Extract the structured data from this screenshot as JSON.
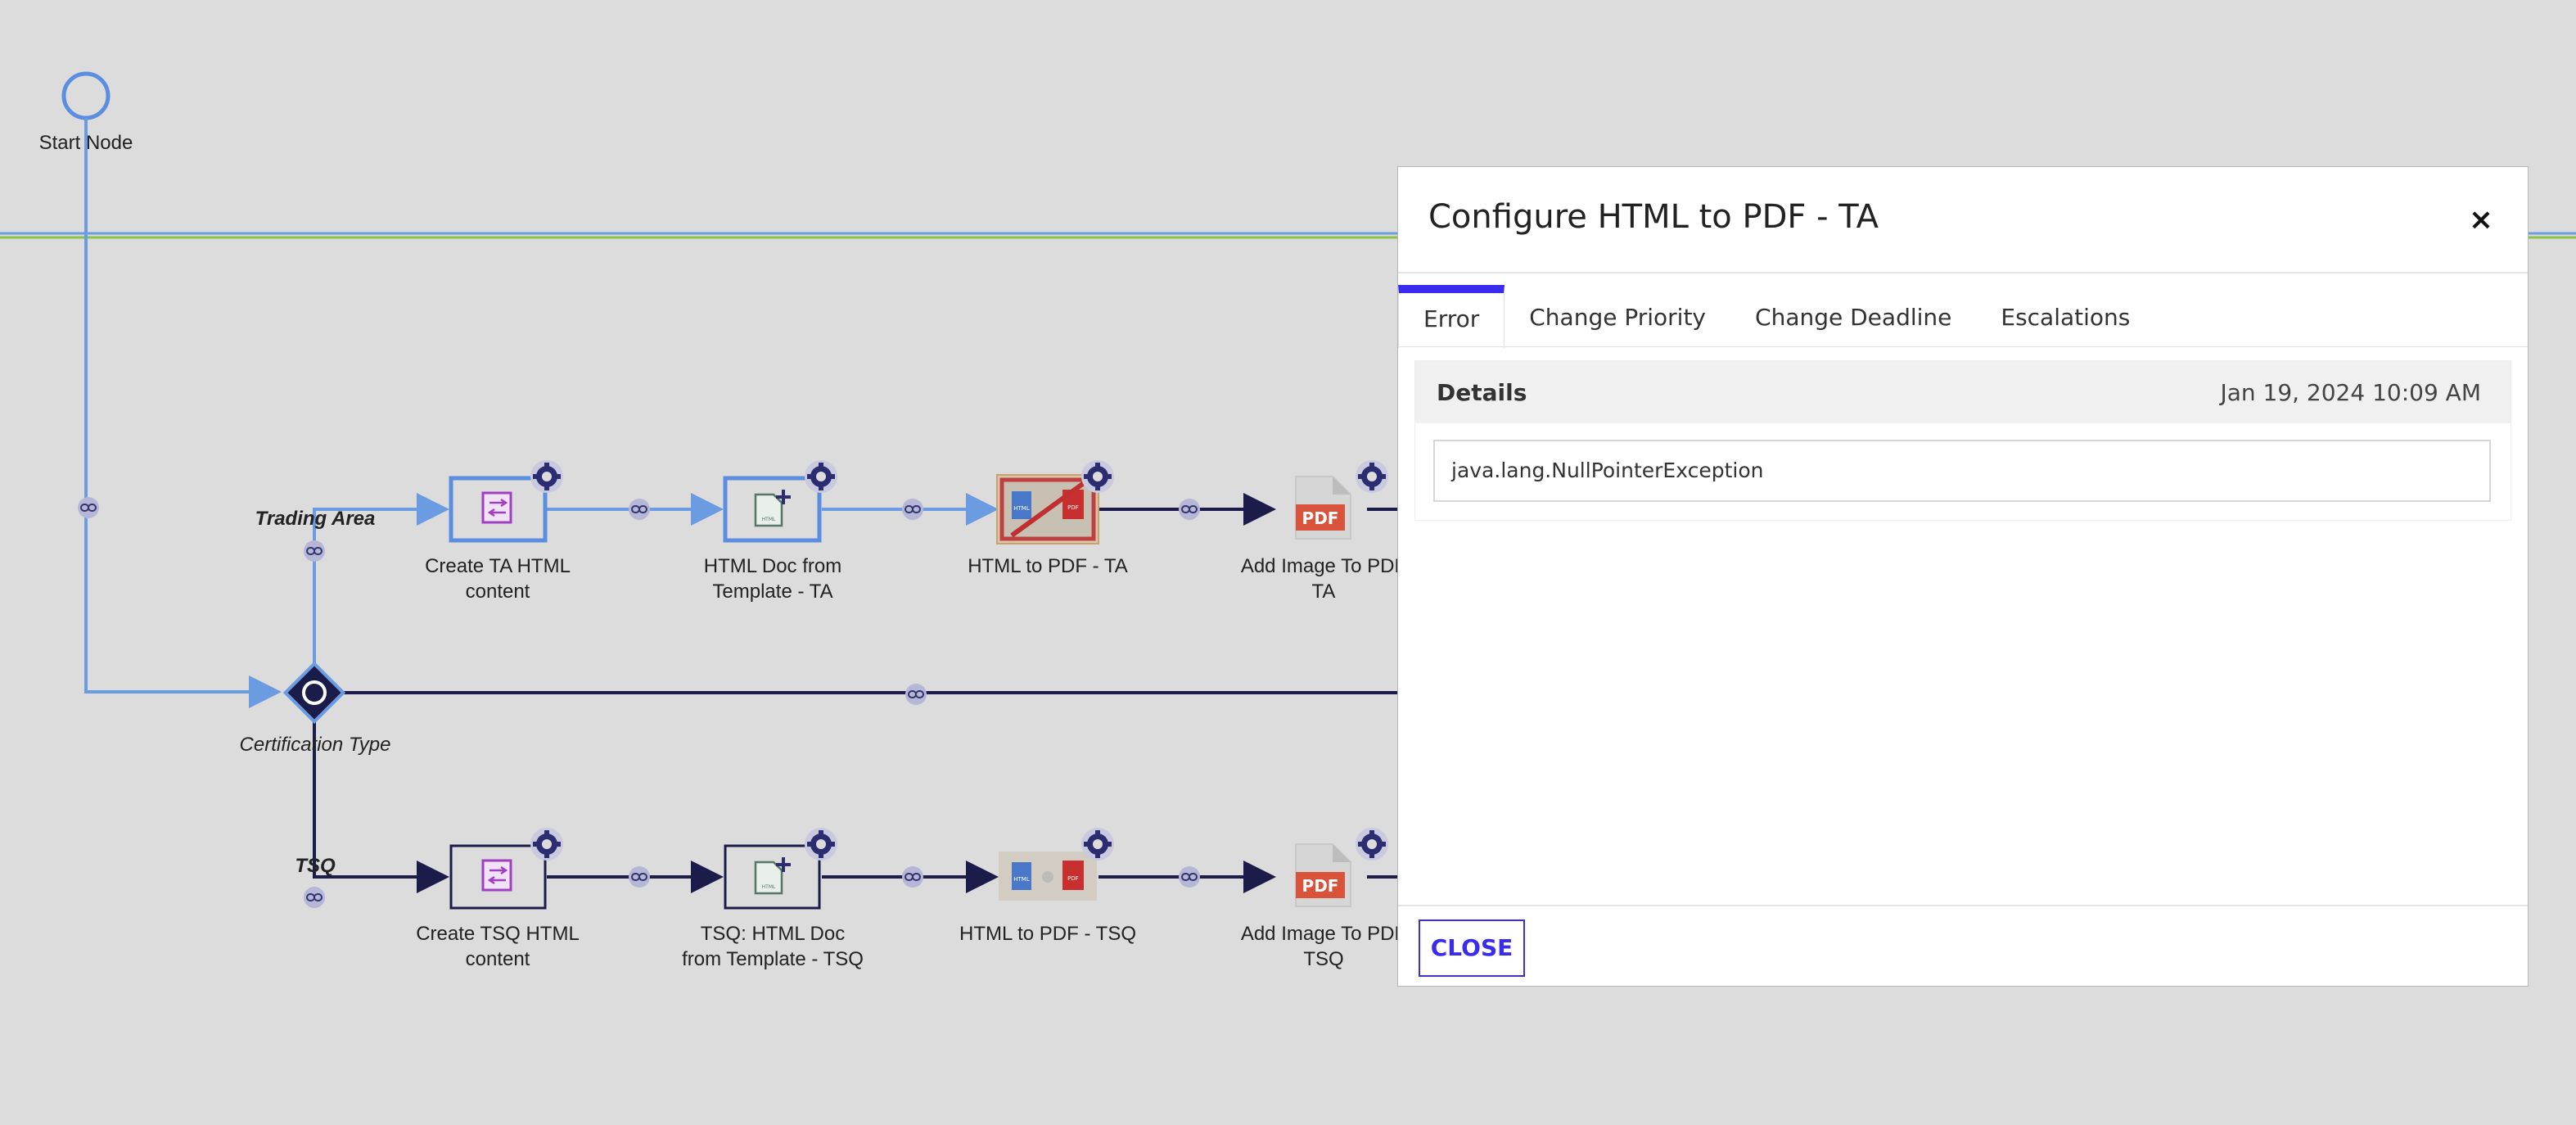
{
  "flow": {
    "start_node": "Start Node",
    "lanes": {
      "trading_area": "Trading Area",
      "tsq": "TSQ"
    },
    "gateway_label": "Certification Type",
    "ta_row": [
      {
        "line1": "Create TA HTML",
        "line2": "content"
      },
      {
        "line1": "HTML Doc from",
        "line2": "Template - TA"
      },
      {
        "line1": "HTML to PDF - TA",
        "line2": ""
      },
      {
        "line1": "Add Image To PDF",
        "line2": "TA"
      }
    ],
    "tsq_row": [
      {
        "line1": "Create TSQ HTML",
        "line2": "content"
      },
      {
        "line1": "TSQ: HTML Doc",
        "line2": "from Template - TSQ"
      },
      {
        "line1": "HTML to PDF - TSQ",
        "line2": ""
      },
      {
        "line1": "Add Image To PDF",
        "line2": "TSQ"
      }
    ],
    "icon_text": {
      "html": "HTML",
      "pdf": "PDF"
    },
    "colors": {
      "active_path": "#6b9be0",
      "inactive_path": "#1c1c4a",
      "node_border_active": "#5b8ee0",
      "gear": "#2c2c70",
      "lane_green": "#8bc34a",
      "lane_blue": "#6b9be0"
    }
  },
  "modal": {
    "title": "Configure HTML to PDF - TA",
    "close_icon": "×",
    "tabs": [
      {
        "label": "Error",
        "active": true
      },
      {
        "label": "Change Priority",
        "active": false
      },
      {
        "label": "Change Deadline",
        "active": false
      },
      {
        "label": "Escalations",
        "active": false
      }
    ],
    "details_label": "Details",
    "details_date": "Jan 19, 2024 10:09 AM",
    "error_value": "java.lang.NullPointerException",
    "close_button": "CLOSE",
    "accent": "#3a2bf0"
  }
}
